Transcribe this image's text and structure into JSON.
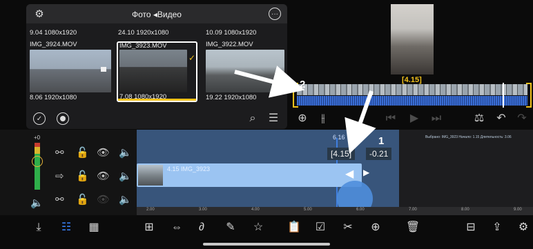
{
  "browser": {
    "title": "Фото ◂Видео",
    "row1": [
      {
        "date": "9.04",
        "res": "1080x1920",
        "name": "IMG_3924.MOV",
        "bottom_date": "8.06",
        "bottom_res": "1920x1080"
      },
      {
        "date": "24.10",
        "res": "1920x1080",
        "name": "IMG_3923.MOV",
        "bottom_date": "7.08",
        "bottom_res": "1080x1920"
      },
      {
        "date": "10.09",
        "res": "1080x1920",
        "name": "IMG_3922.MOV",
        "bottom_date": "19.22",
        "bottom_res": "1920x1080"
      }
    ]
  },
  "preview": {
    "label": "[4.15]"
  },
  "timeline": {
    "time_mark": "6.16",
    "current": "[4.15]",
    "delta": "-0.21",
    "info": "Выбрано: IMG_3923 Начало: 1.15 Длительность: 3.06",
    "clip_label": "4.15 IMG_3923",
    "level_label": "+0",
    "ruler_ticks": [
      "2.00",
      "3.00",
      "4.00",
      "5.00",
      "6.00",
      "7.00",
      "8.00",
      "9.00"
    ]
  },
  "annotations": {
    "one": "1",
    "two": "2"
  }
}
